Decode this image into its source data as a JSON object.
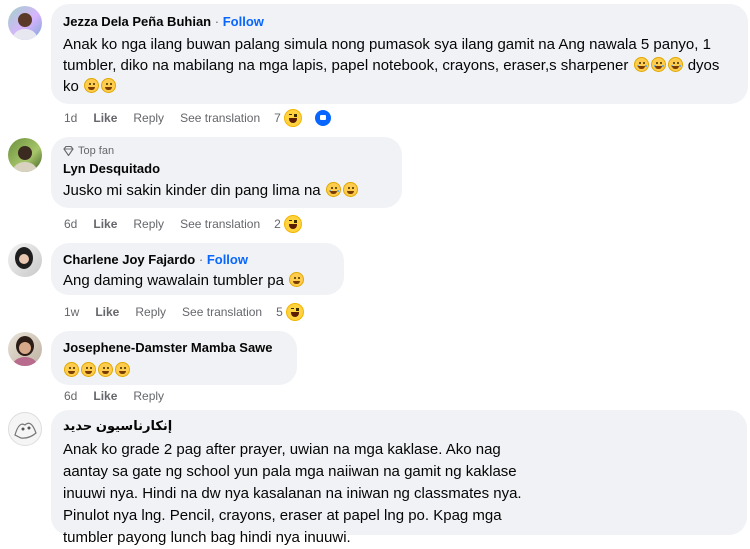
{
  "comments": [
    {
      "name": "Jezza Dela Peña Buhian",
      "follow": "Follow",
      "text": "Anak ko nga ilang buwan palang simula nong pumasok sya ilang gamit na Ang nawala 5 panyo, 1 tumbler, diko na mabilang na mga lapis, papel notebook, crayons, eraser,s sharpener",
      "text_tail": "dyos ko",
      "time": "1d",
      "like": "Like",
      "reply": "Reply",
      "translate": "See translation",
      "reactions": "7"
    },
    {
      "badge": "Top fan",
      "name": "Lyn Desquitado",
      "text": "Jusko mi sakin kinder din pang lima na",
      "time": "6d",
      "like": "Like",
      "reply": "Reply",
      "translate": "See translation",
      "reactions": "2"
    },
    {
      "name": "Charlene Joy Fajardo",
      "follow": "Follow",
      "text": "Ang daming wawalain tumbler pa",
      "time": "1w",
      "like": "Like",
      "reply": "Reply",
      "translate": "See translation",
      "reactions": "5"
    },
    {
      "name": "Josephene-Damster Mamba Sawe",
      "text": "",
      "time": "6d",
      "like": "Like",
      "reply": "Reply"
    },
    {
      "name": "إنكارناسيون حديد",
      "text": "Anak ko grade 2 pag after prayer, uwian na mga kaklase. Ako nag aantay sa gate ng school yun pala mga naiiwan na gamit ng kaklase inuuwi nya. Hindi na dw nya kasalanan na iniwan ng classmates nya. Pinulot nya lng. Pencil, crayons, eraser at papel lng po. Kpag mga tumbler payong lunch bag hindi nya inuuwi."
    }
  ],
  "separator": "·",
  "colors": {
    "bubble": "#f0f2f5",
    "follow": "#0866ff",
    "meta": "#65676b"
  }
}
